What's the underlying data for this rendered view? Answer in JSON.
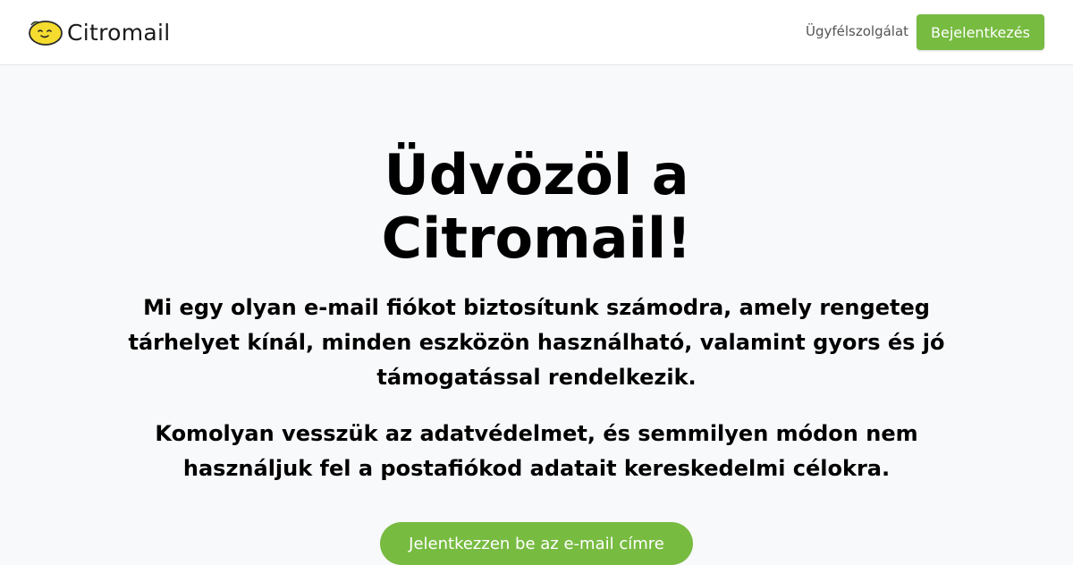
{
  "header": {
    "brand_name": "Citromail",
    "support_label": "Ügyfélszolgálat",
    "login_label": "Bejelentkezés"
  },
  "hero": {
    "title": "Üdvözöl a Citromail!",
    "paragraph1": "Mi egy olyan e-mail fiókot biztosítunk számodra, amely rengeteg tárhelyet kínál, minden eszközön használható, valamint gyors és jó támogatással rendelkezik.",
    "paragraph2": "Komolyan vesszük az adatvédelmet, és semmilyen módon nem használjuk fel a postafiókod adatait kereskedelmi célokra.",
    "cta_label": "Jelentkezzen be az e-mail címre"
  },
  "colors": {
    "accent": "#77bb41",
    "background": "#f8f9fb",
    "header_bg": "#ffffff"
  },
  "icons": {
    "logo": "lemon-icon"
  }
}
